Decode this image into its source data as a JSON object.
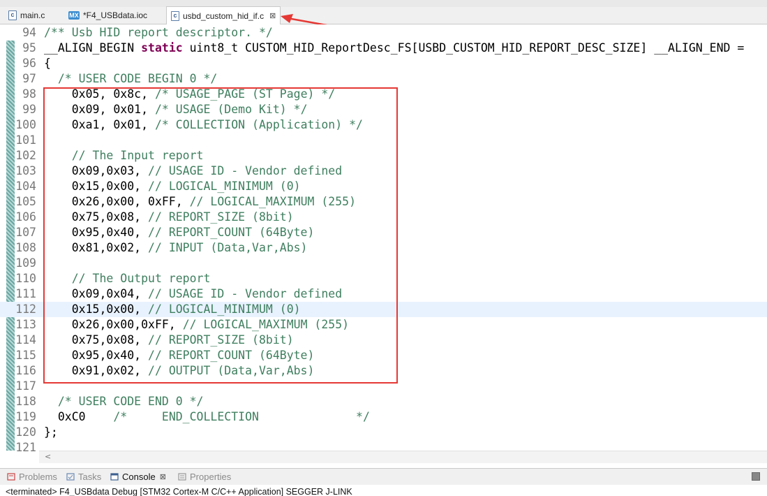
{
  "tabs": [
    {
      "label": "main.c",
      "icon": "c-file-icon"
    },
    {
      "label": "*F4_USBdata.ioc",
      "icon": "mx-file-icon"
    },
    {
      "label": "usbd_custom_hid_if.c",
      "icon": "c-file-icon",
      "active": true
    }
  ],
  "tab_close_glyph": "⊠",
  "editor_lines": [
    {
      "n": "94",
      "parts": [
        {
          "t": "/** Usb HID report descriptor. */",
          "c": "cm"
        }
      ]
    },
    {
      "n": "95",
      "parts": [
        {
          "t": "__ALIGN_BEGIN ",
          "c": ""
        },
        {
          "t": "static",
          "c": "kw"
        },
        {
          "t": " uint8_t CUSTOM_HID_ReportDesc_FS[USBD_CUSTOM_HID_REPORT_DESC_SIZE] __ALIGN_END =",
          "c": ""
        }
      ]
    },
    {
      "n": "96",
      "parts": [
        {
          "t": "{",
          "c": ""
        }
      ]
    },
    {
      "n": "97",
      "parts": [
        {
          "t": "  /* USER CODE BEGIN 0 */",
          "c": "cm"
        }
      ]
    },
    {
      "n": "98",
      "parts": [
        {
          "t": "    0x05, 0x8c, ",
          "c": ""
        },
        {
          "t": "/* USAGE_PAGE (ST Page) */",
          "c": "cm"
        }
      ]
    },
    {
      "n": "99",
      "parts": [
        {
          "t": "    0x09, 0x01, ",
          "c": ""
        },
        {
          "t": "/* USAGE (Demo Kit) */",
          "c": "cm"
        }
      ]
    },
    {
      "n": "100",
      "parts": [
        {
          "t": "    0xa1, 0x01, ",
          "c": ""
        },
        {
          "t": "/* COLLECTION (Application) */",
          "c": "cm"
        }
      ]
    },
    {
      "n": "101",
      "parts": []
    },
    {
      "n": "102",
      "parts": [
        {
          "t": "    // The Input report",
          "c": "cm"
        }
      ]
    },
    {
      "n": "103",
      "parts": [
        {
          "t": "    0x09,0x03, ",
          "c": ""
        },
        {
          "t": "// USAGE ID - Vendor defined",
          "c": "cm"
        }
      ]
    },
    {
      "n": "104",
      "parts": [
        {
          "t": "    0x15,0x00, ",
          "c": ""
        },
        {
          "t": "// LOGICAL_MINIMUM (0)",
          "c": "cm"
        }
      ]
    },
    {
      "n": "105",
      "parts": [
        {
          "t": "    0x26,0x00, 0xFF, ",
          "c": ""
        },
        {
          "t": "// LOGICAL_MAXIMUM (255)",
          "c": "cm"
        }
      ]
    },
    {
      "n": "106",
      "parts": [
        {
          "t": "    0x75,0x08, ",
          "c": ""
        },
        {
          "t": "// REPORT_SIZE (8bit)",
          "c": "cm"
        }
      ]
    },
    {
      "n": "107",
      "parts": [
        {
          "t": "    0x95,0x40, ",
          "c": ""
        },
        {
          "t": "// REPORT_COUNT (64Byte)",
          "c": "cm"
        }
      ]
    },
    {
      "n": "108",
      "parts": [
        {
          "t": "    0x81,0x02, ",
          "c": ""
        },
        {
          "t": "// INPUT (Data,Var,Abs)",
          "c": "cm"
        }
      ]
    },
    {
      "n": "109",
      "parts": []
    },
    {
      "n": "110",
      "parts": [
        {
          "t": "    // The Output report",
          "c": "cm"
        }
      ]
    },
    {
      "n": "111",
      "parts": [
        {
          "t": "    0x09,0x04, ",
          "c": ""
        },
        {
          "t": "// USAGE ID - Vendor defined",
          "c": "cm"
        }
      ]
    },
    {
      "n": "112",
      "parts": [
        {
          "t": "    0x15,0x00, ",
          "c": ""
        },
        {
          "t": "// LOGICAL_MINIMUM (0)",
          "c": "cm"
        }
      ],
      "highlight": true
    },
    {
      "n": "113",
      "parts": [
        {
          "t": "    0x26,0x00,0xFF, ",
          "c": ""
        },
        {
          "t": "// LOGICAL_MAXIMUM (255)",
          "c": "cm"
        }
      ]
    },
    {
      "n": "114",
      "parts": [
        {
          "t": "    0x75,0x08, ",
          "c": ""
        },
        {
          "t": "// REPORT_SIZE (8bit)",
          "c": "cm"
        }
      ]
    },
    {
      "n": "115",
      "parts": [
        {
          "t": "    0x95,0x40, ",
          "c": ""
        },
        {
          "t": "// REPORT_COUNT (64Byte)",
          "c": "cm"
        }
      ]
    },
    {
      "n": "116",
      "parts": [
        {
          "t": "    0x91,0x02, ",
          "c": ""
        },
        {
          "t": "// OUTPUT (Data,Var,Abs)",
          "c": "cm"
        }
      ]
    },
    {
      "n": "117",
      "parts": []
    },
    {
      "n": "118",
      "parts": [
        {
          "t": "  /* USER CODE END 0 */",
          "c": "cm"
        }
      ]
    },
    {
      "n": "119",
      "parts": [
        {
          "t": "  0xC0    ",
          "c": ""
        },
        {
          "t": "/*     END_COLLECTION              */",
          "c": "cm"
        }
      ]
    },
    {
      "n": "120",
      "parts": [
        {
          "t": "};",
          "c": ""
        }
      ]
    },
    {
      "n": "121",
      "parts": []
    }
  ],
  "bottom_tabs": [
    {
      "label": "Problems",
      "icon": "problems-icon",
      "active": false
    },
    {
      "label": "Tasks",
      "icon": "tasks-icon",
      "active": false
    },
    {
      "label": "Console",
      "icon": "console-icon",
      "active": true
    },
    {
      "label": "Properties",
      "icon": "properties-icon",
      "active": false
    }
  ],
  "status_text": "<terminated> F4_USBdata Debug [STM32 Cortex-M C/C++ Application] SEGGER J-LINK",
  "colors": {
    "annotation_red": "#e53935",
    "comment_green": "#3f7f5f",
    "keyword_purple": "#7f0055"
  }
}
